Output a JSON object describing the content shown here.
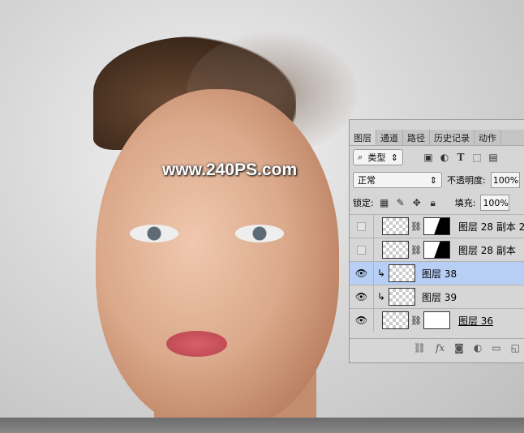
{
  "watermark": "www.240PS.com",
  "panel": {
    "tabs": [
      {
        "label": "图层",
        "active": true
      },
      {
        "label": "通道"
      },
      {
        "label": "路径"
      },
      {
        "label": "历史记录"
      },
      {
        "label": "动作"
      }
    ],
    "filter": {
      "label": "类型"
    },
    "blend_mode": "正常",
    "opacity_label": "不透明度:",
    "opacity_value": "100%",
    "lock_label": "锁定:",
    "fill_label": "填充:",
    "fill_value": "100%",
    "layers": [
      {
        "name": "图层 28 副本 2",
        "visible": false
      },
      {
        "name": "图层 28 副本",
        "visible": false
      },
      {
        "name": "图层 38",
        "visible": true,
        "selected": true
      },
      {
        "name": "图层 39",
        "visible": true
      },
      {
        "name": "图层 36",
        "visible": true
      }
    ],
    "selection_color": "#b8cff5"
  }
}
